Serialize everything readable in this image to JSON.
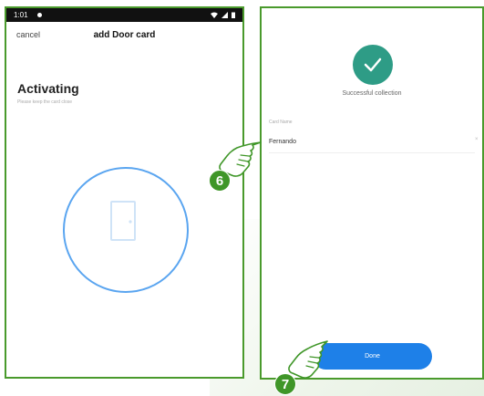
{
  "left_screen": {
    "status": {
      "time": "1:01"
    },
    "header": {
      "cancel_label": "cancel",
      "title": "add Door card"
    },
    "heading": "Activating",
    "subtitle": "Please keep the card close",
    "icon": "door-icon"
  },
  "right_screen": {
    "success_message": "Successful collection",
    "card_name_label": "Card Name",
    "card_name_value": "Fernando",
    "clear_symbol": "×",
    "done_label": "Done",
    "icon": "check-icon"
  },
  "steps": [
    {
      "number": "6",
      "icon": "pointing-hand-icon"
    },
    {
      "number": "7",
      "icon": "pointing-hand-icon"
    }
  ],
  "colors": {
    "frame_green": "#4a9a2c",
    "badge_green": "#3f9628",
    "check_teal": "#2e9c86",
    "ring_blue": "#5aa5f0",
    "button_blue": "#1e80e8"
  }
}
